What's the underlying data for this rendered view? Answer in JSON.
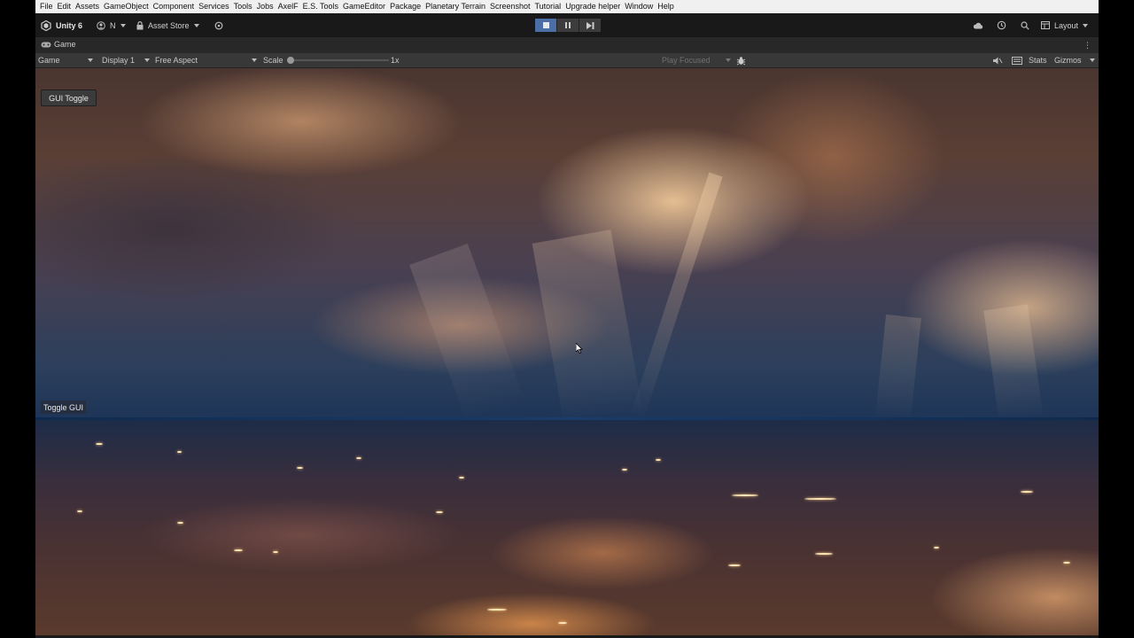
{
  "menu": [
    "File",
    "Edit",
    "Assets",
    "GameObject",
    "Component",
    "Services",
    "Tools",
    "Jobs",
    "AxelF",
    "E.S. Tools",
    "GameEditor",
    "Package",
    "Planetary Terrain",
    "Screenshot",
    "Tutorial",
    "Upgrade helper",
    "Window",
    "Help"
  ],
  "toolbar": {
    "app_name": "Unity 6",
    "account_label": "N",
    "asset_store_label": "Asset Store",
    "layout_label": "Layout"
  },
  "game_tab": {
    "label": "Game"
  },
  "game_toolbar": {
    "view_mode": "Game",
    "display": "Display 1",
    "aspect": "Free Aspect",
    "scale_label": "Scale",
    "scale_value": "1x",
    "play_mode": "Play Focused",
    "stats_label": "Stats",
    "gizmos_label": "Gizmos"
  },
  "viewport": {
    "gui_toggle_label": "GUI Toggle",
    "toggle_gui_label": "Toggle GUI"
  },
  "colors": {
    "play_active": "#4b6ea6",
    "toolbar_bg": "#191919",
    "menubar_bg": "#f0f0f0"
  }
}
